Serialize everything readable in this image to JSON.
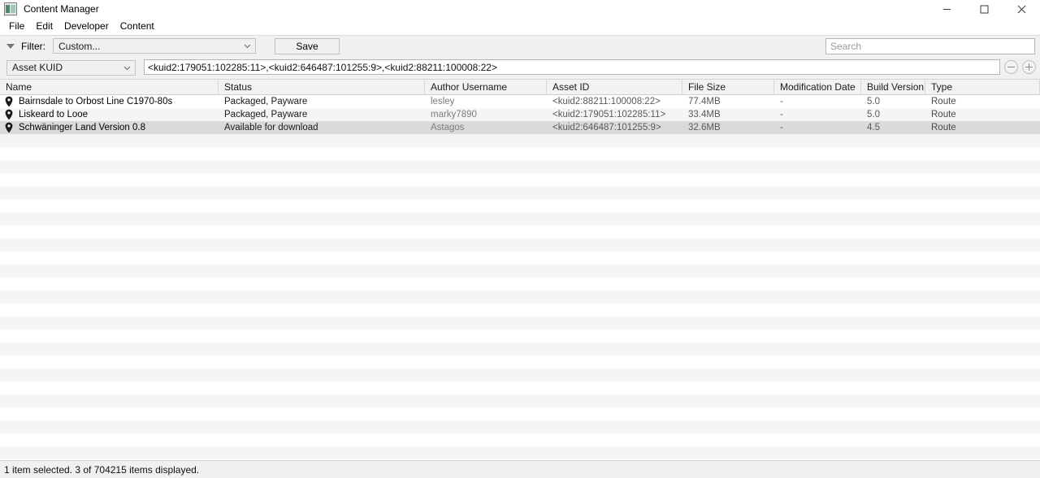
{
  "window": {
    "title": "Content Manager",
    "icon": "app-window-icon",
    "controls": {
      "minimize": "minimize-icon",
      "maximize": "maximize-icon",
      "close": "close-icon"
    }
  },
  "menubar": {
    "items": [
      "File",
      "Edit",
      "Developer",
      "Content"
    ]
  },
  "toolbar": {
    "filter_caret": "triangle-down-icon",
    "filter_label": "Filter:",
    "filter_value": "Custom...",
    "save_label": "Save",
    "search_placeholder": "Search",
    "search_value": ""
  },
  "kuidbar": {
    "criteria_value": "Asset KUID",
    "kuid_value": "<kuid2:179051:102285:11>,<kuid2:646487:101255:9>,<kuid2:88211:100008:22>",
    "remove_label": "minus-circle-icon",
    "add_label": "plus-circle-icon"
  },
  "table": {
    "columns": [
      "Name",
      "Status",
      "Author Username",
      "Asset ID",
      "File Size",
      "Modification Date",
      "Build Version",
      "Type"
    ],
    "rows": [
      {
        "icon": "map-pin-icon",
        "name": "Bairnsdale to Orbost Line C1970-80s",
        "status": "Packaged, Payware",
        "author": "lesley",
        "asset_id": "<kuid2:88211:100008:22>",
        "file_size": "77.4MB",
        "modification_date": "-",
        "build_version": "5.0",
        "type": "Route",
        "selected": false
      },
      {
        "icon": "map-pin-icon",
        "name": "Liskeard to Looe",
        "status": "Packaged, Payware",
        "author": "marky7890",
        "asset_id": "<kuid2:179051:102285:11>",
        "file_size": "33.4MB",
        "modification_date": "-",
        "build_version": "5.0",
        "type": "Route",
        "selected": false
      },
      {
        "icon": "map-pin-icon",
        "name": "Schwäninger Land Version 0.8",
        "status": "Available for download",
        "author": "Astagos",
        "asset_id": "<kuid2:646487:101255:9>",
        "file_size": "32.6MB",
        "modification_date": "-",
        "build_version": "4.5",
        "type": "Route",
        "selected": true
      }
    ],
    "empty_row_count": 25
  },
  "statusbar": {
    "text": "1 item selected. 3 of 704215 items displayed."
  },
  "colors": {
    "toolbar_bg": "#f0f0f0",
    "header_bg": "#f2f2f2",
    "row_alt_bg": "#f5f5f5",
    "row_selected_bg": "#dadada",
    "muted_text": "#808080"
  }
}
